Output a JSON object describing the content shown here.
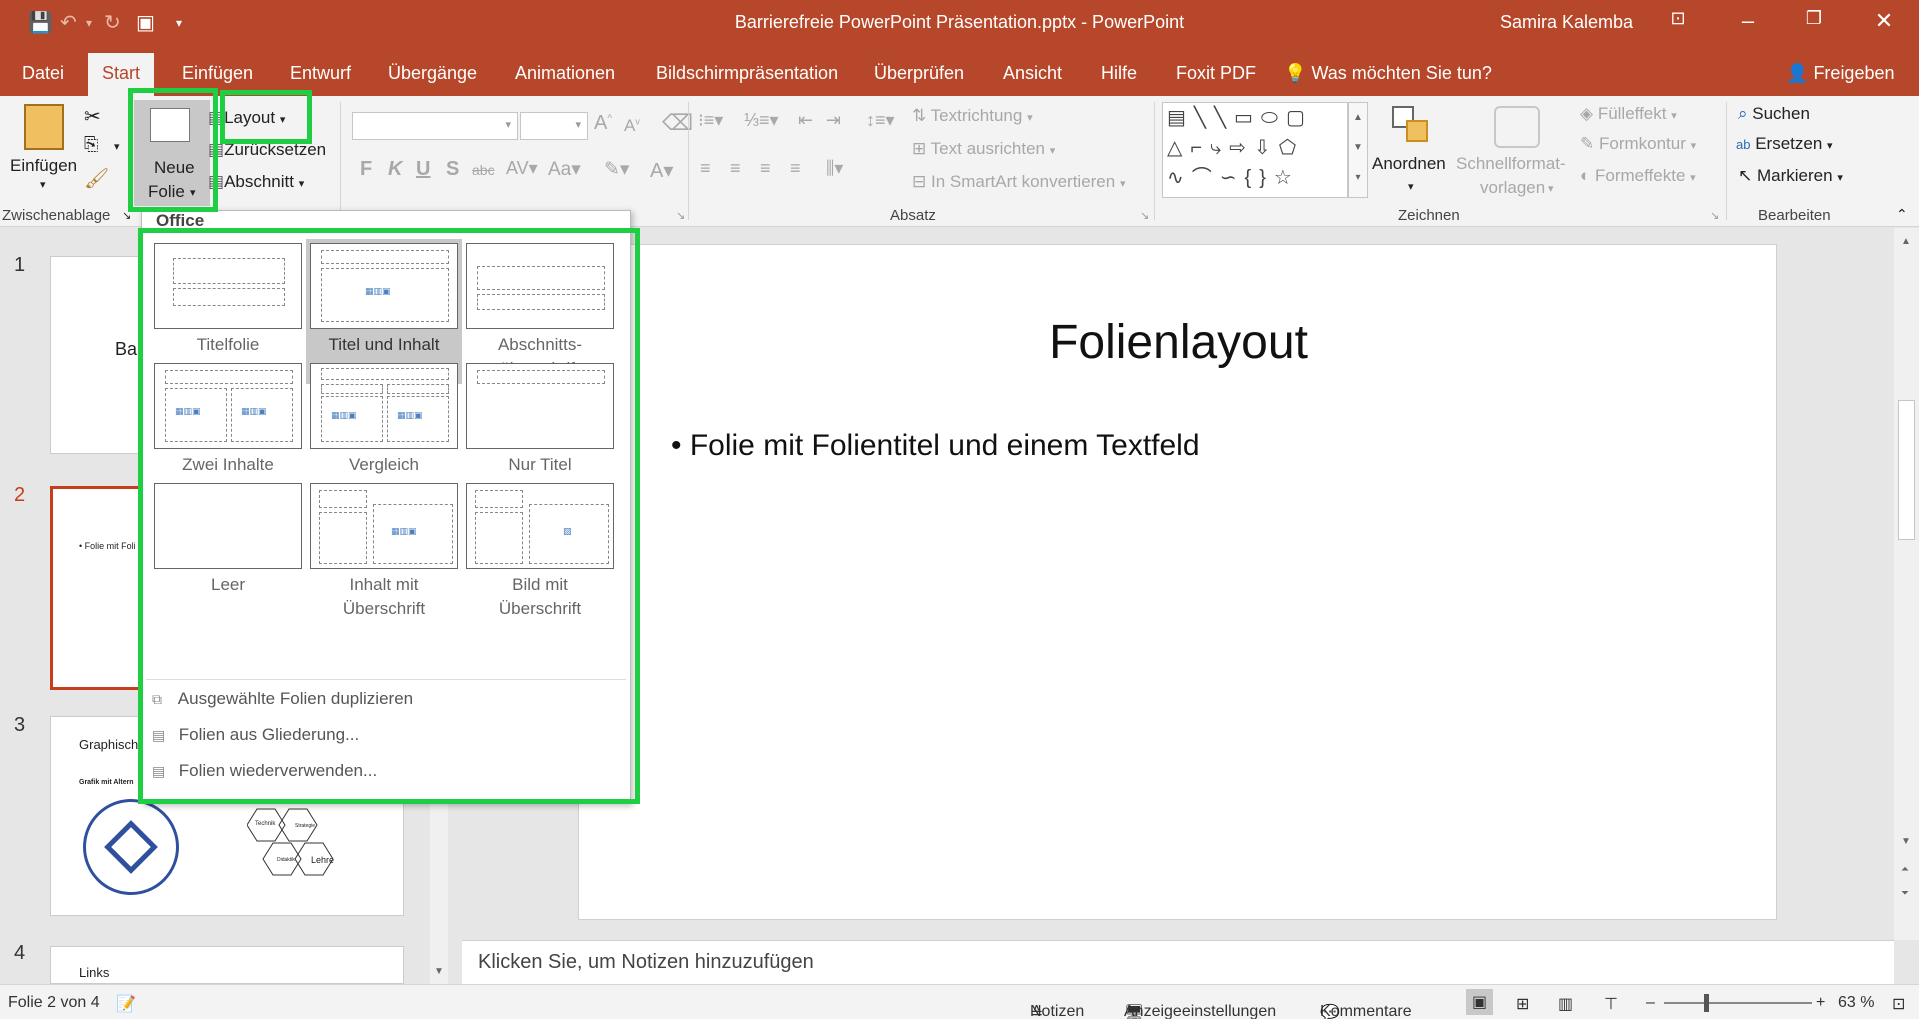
{
  "window": {
    "title": "Barrierefreie PowerPoint Präsentation.pptx  -  PowerPoint",
    "user": "Samira Kalemba"
  },
  "tabs": [
    "Datei",
    "Start",
    "Einfügen",
    "Entwurf",
    "Übergänge",
    "Animationen",
    "Bildschirmpräsentation",
    "Überprüfen",
    "Ansicht",
    "Hilfe",
    "Foxit PDF"
  ],
  "tell_me": "Was möchten Sie tun?",
  "share": "Freigeben",
  "ribbon": {
    "paste": "Einfügen",
    "new_slide_line1": "Neue",
    "new_slide_line2": "Folie",
    "layout": "Layout",
    "reset": "Zurücksetzen",
    "section": "Abschnitt",
    "text_direction": "Textrichtung",
    "align_text": "Text ausrichten",
    "smartart": "In SmartArt konvertieren",
    "arrange": "Anordnen",
    "quick_styles_line1": "Schnellformat-",
    "quick_styles_line2": "vorlagen",
    "fill": "Fülleffekt",
    "outline": "Formkontur",
    "effects": "Formeffekte",
    "find": "Suchen",
    "replace": "Ersetzen",
    "select": "Markieren",
    "bold": "F",
    "italic": "K",
    "underline": "U",
    "strike": "S",
    "case": "Aa",
    "groups": {
      "clipboard": "Zwischenablage",
      "paragraph": "Absatz",
      "drawing": "Zeichnen",
      "editing": "Bearbeiten"
    }
  },
  "dropdown": {
    "header": "Office",
    "layouts": [
      {
        "label_line1": "Titelfolie",
        "label_line2": ""
      },
      {
        "label_line1": "Titel und Inhalt",
        "label_line2": ""
      },
      {
        "label_line1": "Abschnitts-",
        "label_line2": "überschrift"
      },
      {
        "label_line1": "Zwei Inhalte",
        "label_line2": ""
      },
      {
        "label_line1": "Vergleich",
        "label_line2": ""
      },
      {
        "label_line1": "Nur Titel",
        "label_line2": ""
      },
      {
        "label_line1": "Leer",
        "label_line2": ""
      },
      {
        "label_line1": "Inhalt mit",
        "label_line2": "Überschrift"
      },
      {
        "label_line1": "Bild mit",
        "label_line2": "Überschrift"
      }
    ],
    "selected_layout": "Titel und Inhalt",
    "actions": [
      "Ausgewählte Folien duplizieren",
      "Folien aus Gliederung...",
      "Folien wiederverwenden..."
    ]
  },
  "thumbnails": {
    "numbers": [
      "1",
      "2",
      "3",
      "4"
    ],
    "slide1_text": "Ba",
    "slide2_text": "• Folie mit Foli",
    "slide3_title": "Graphisch",
    "slide3_sub": "Grafik mit Altern",
    "slide3_hex": [
      "Technik",
      "Strategie",
      "Didaktik",
      "Lehre"
    ],
    "slide4_title": "Links"
  },
  "slide": {
    "title": "Folienlayout",
    "bullet": "Folie mit Folientitel und einem Textfeld"
  },
  "notes_placeholder": "Klicken Sie, um Notizen hinzuzufügen",
  "status": {
    "slide_of": "Folie 2 von 4",
    "notes": "Notizen",
    "display": "Anzeigeeinstellungen",
    "comments": "Kommentare",
    "zoom": "63 %"
  },
  "colors": {
    "accent": "#b7472a",
    "highlight": "#1ecf43",
    "selected_border": "#c43e1c"
  }
}
